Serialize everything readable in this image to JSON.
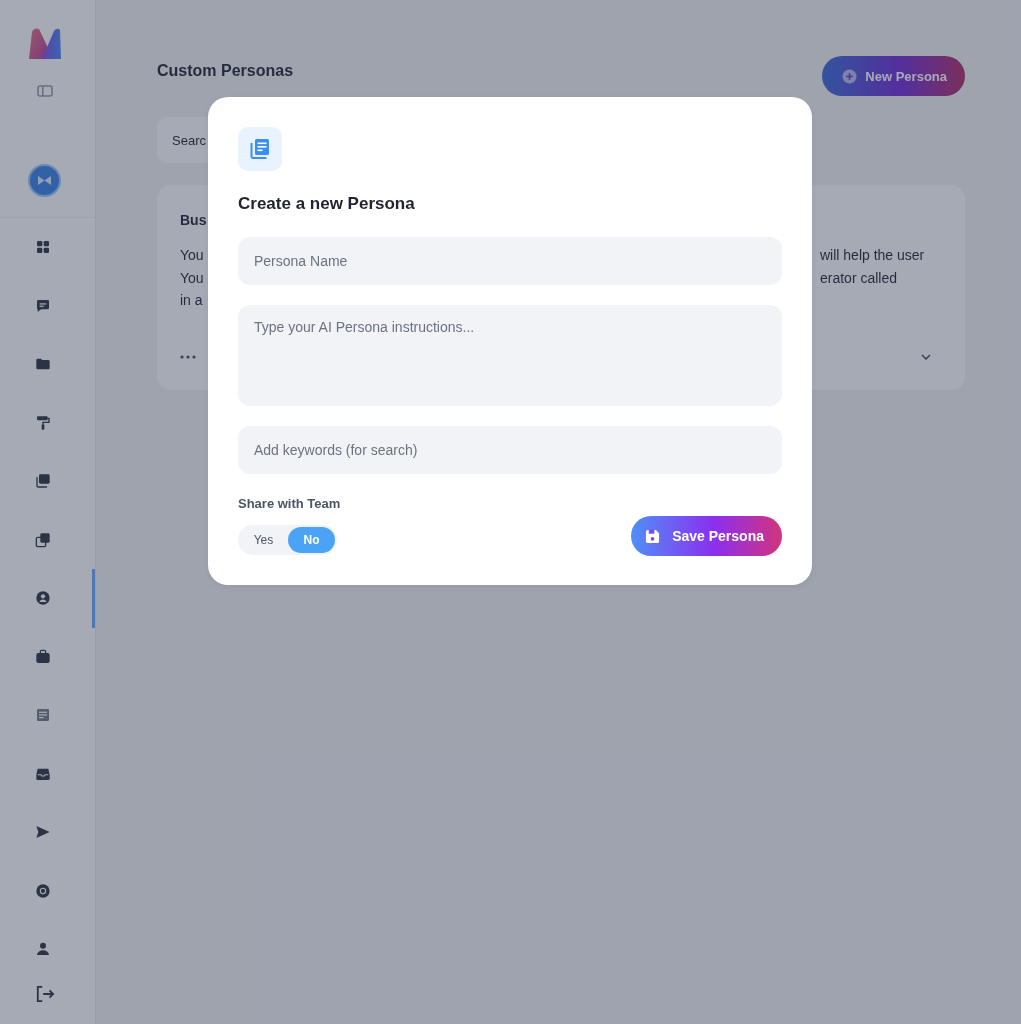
{
  "sidebar": {
    "nav": [
      {
        "selected": false
      },
      {
        "selected": false
      },
      {
        "selected": false
      },
      {
        "selected": false
      },
      {
        "selected": false
      },
      {
        "selected": false
      },
      {
        "selected": true
      },
      {
        "selected": false
      },
      {
        "selected": false
      },
      {
        "selected": false
      },
      {
        "selected": false
      },
      {
        "selected": false
      },
      {
        "selected": false
      }
    ]
  },
  "page": {
    "title": "Custom Personas",
    "new_button": "New Persona",
    "search": {
      "placeholder": "Searc"
    },
    "card": {
      "title": "Bus",
      "left_lines": [
        "You",
        "You",
        "in a"
      ],
      "right_lines": [
        "will help the user",
        "erator called"
      ]
    }
  },
  "dialog": {
    "title": "Create a new Persona",
    "fields": [
      {
        "kind": "input",
        "placeholder": "Persona Name"
      },
      {
        "kind": "textarea",
        "placeholder": "Type your AI Persona instructions..."
      },
      {
        "kind": "input",
        "placeholder": "Add keywords (for search)"
      }
    ],
    "share": {
      "label": "Share with Team",
      "options": [
        {
          "label": "Yes",
          "selected": false
        },
        {
          "label": "No",
          "selected": true
        }
      ]
    },
    "save_button": "Save Persona"
  }
}
